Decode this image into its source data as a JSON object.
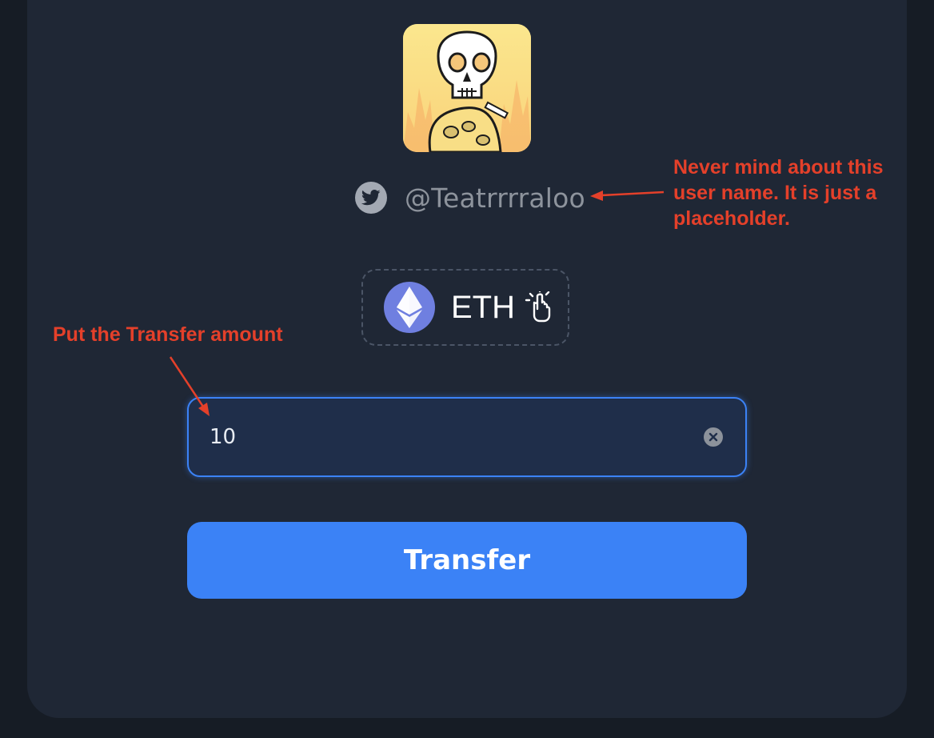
{
  "profile": {
    "avatar_icon": "skull-nft-avatar",
    "username": "@Teatrrrraloo"
  },
  "token": {
    "symbol": "ETH",
    "logo_icon": "ethereum-logo-icon",
    "select_icon": "tap-hand-icon"
  },
  "amount": {
    "value": "10",
    "clear_icon": "clear-x-icon"
  },
  "actions": {
    "transfer_label": "Transfer"
  },
  "annotations": {
    "username_note": "Never mind about this user name. It is just a placeholder.",
    "amount_note": "Put the Transfer amount"
  },
  "colors": {
    "background": "#161c25",
    "card": "#1f2735",
    "accent": "#3b82f6",
    "annotation": "#e4402a",
    "eth": "#6f7fe0"
  }
}
